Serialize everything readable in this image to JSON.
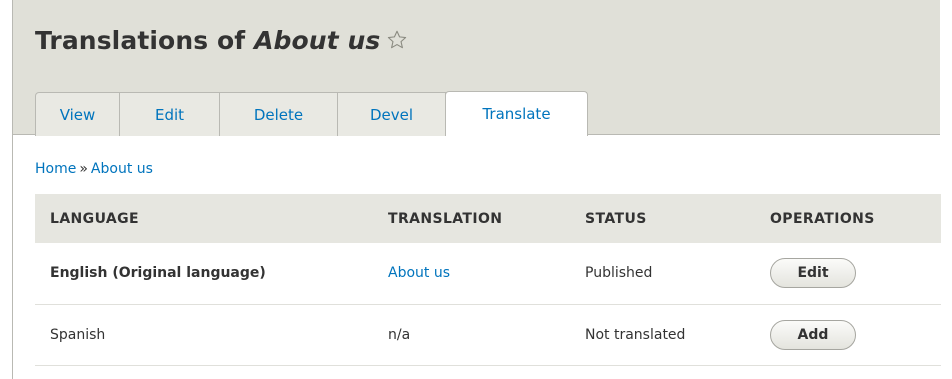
{
  "page": {
    "title_prefix": "Translations of ",
    "title_emphasis": "About us"
  },
  "tabs": [
    {
      "label": "View"
    },
    {
      "label": "Edit"
    },
    {
      "label": "Delete"
    },
    {
      "label": "Devel"
    },
    {
      "label": "Translate",
      "active": true
    }
  ],
  "breadcrumb": {
    "items": [
      "Home",
      "About us"
    ],
    "separator": "»"
  },
  "table": {
    "headers": [
      "LANGUAGE",
      "TRANSLATION",
      "STATUS",
      "OPERATIONS"
    ],
    "rows": [
      {
        "language": "English (Original language)",
        "translation": "About us",
        "status": "Published",
        "operation": "Edit"
      },
      {
        "language": "Spanish",
        "translation": "n/a",
        "status": "Not translated",
        "operation": "Add"
      }
    ]
  },
  "colors": {
    "link": "#0074bd",
    "header_bg": "#e0e0d8",
    "table_header_bg": "#e6e6e0"
  },
  "icons": {
    "favorite": "star-outline-icon"
  }
}
